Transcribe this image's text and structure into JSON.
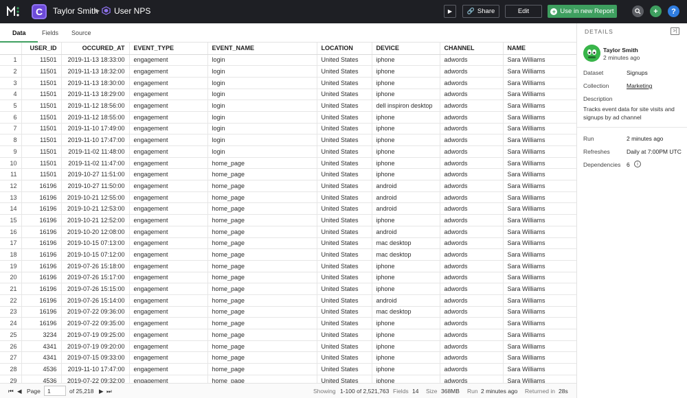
{
  "topbar": {
    "app_initial": "C",
    "user": "Taylor Smith",
    "title": "User NPS",
    "share_label": "Share",
    "edit_label": "Edit",
    "use_label": "Use in new Report",
    "help_label": "?"
  },
  "tabs": [
    {
      "label": "Data"
    },
    {
      "label": "Fields"
    },
    {
      "label": "Source"
    }
  ],
  "table": {
    "columns": [
      "USER_ID",
      "OCCURED_AT",
      "EVENT_TYPE",
      "EVENT_NAME",
      "LOCATION",
      "DEVICE",
      "CHANNEL",
      "NAME"
    ],
    "rows": [
      [
        "1",
        "11501",
        "2019-11-13 18:33:00",
        "engagement",
        "login",
        "United States",
        "iphone",
        "adwords",
        "Sara Williams"
      ],
      [
        "2",
        "11501",
        "2019-11-13 18:32:00",
        "engagement",
        "login",
        "United States",
        "iphone",
        "adwords",
        "Sara Williams"
      ],
      [
        "3",
        "11501",
        "2019-11-13 18:30:00",
        "engagement",
        "login",
        "United States",
        "iphone",
        "adwords",
        "Sara Williams"
      ],
      [
        "4",
        "11501",
        "2019-11-13 18:29:00",
        "engagement",
        "login",
        "United States",
        "iphone",
        "adwords",
        "Sara Williams"
      ],
      [
        "5",
        "11501",
        "2019-11-12 18:56:00",
        "engagement",
        "login",
        "United States",
        "dell inspiron desktop",
        "adwords",
        "Sara Williams"
      ],
      [
        "6",
        "11501",
        "2019-11-12 18:55:00",
        "engagement",
        "login",
        "United States",
        "iphone",
        "adwords",
        "Sara Williams"
      ],
      [
        "7",
        "11501",
        "2019-11-10 17:49:00",
        "engagement",
        "login",
        "United States",
        "iphone",
        "adwords",
        "Sara Williams"
      ],
      [
        "8",
        "11501",
        "2019-11-10 17:47:00",
        "engagement",
        "login",
        "United States",
        "iphone",
        "adwords",
        "Sara Williams"
      ],
      [
        "9",
        "11501",
        "2019-11-02 11:48:00",
        "engagement",
        "login",
        "United States",
        "iphone",
        "adwords",
        "Sara Williams"
      ],
      [
        "10",
        "11501",
        "2019-11-02 11:47:00",
        "engagement",
        "home_page",
        "United States",
        "iphone",
        "adwords",
        "Sara Williams"
      ],
      [
        "11",
        "11501",
        "2019-10-27 11:51:00",
        "engagement",
        "home_page",
        "United States",
        "iphone",
        "adwords",
        "Sara Williams"
      ],
      [
        "12",
        "16196",
        "2019-10-27 11:50:00",
        "engagement",
        "home_page",
        "United States",
        "android",
        "adwords",
        "Sara Williams"
      ],
      [
        "13",
        "16196",
        "2019-10-21 12:55:00",
        "engagement",
        "home_page",
        "United States",
        "android",
        "adwords",
        "Sara Williams"
      ],
      [
        "14",
        "16196",
        "2019-10-21 12:53:00",
        "engagement",
        "home_page",
        "United States",
        "android",
        "adwords",
        "Sara Williams"
      ],
      [
        "15",
        "16196",
        "2019-10-21 12:52:00",
        "engagement",
        "home_page",
        "United States",
        "iphone",
        "adwords",
        "Sara Williams"
      ],
      [
        "16",
        "16196",
        "2019-10-20 12:08:00",
        "engagement",
        "home_page",
        "United States",
        "android",
        "adwords",
        "Sara Williams"
      ],
      [
        "17",
        "16196",
        "2019-10-15 07:13:00",
        "engagement",
        "home_page",
        "United States",
        "mac desktop",
        "adwords",
        "Sara Williams"
      ],
      [
        "18",
        "16196",
        "2019-10-15 07:12:00",
        "engagement",
        "home_page",
        "United States",
        "mac desktop",
        "adwords",
        "Sara Williams"
      ],
      [
        "19",
        "16196",
        "2019-07-26 15:18:00",
        "engagement",
        "home_page",
        "United States",
        "iphone",
        "adwords",
        "Sara Williams"
      ],
      [
        "20",
        "16196",
        "2019-07-26 15:17:00",
        "engagement",
        "home_page",
        "United States",
        "iphone",
        "adwords",
        "Sara Williams"
      ],
      [
        "21",
        "16196",
        "2019-07-26 15:15:00",
        "engagement",
        "home_page",
        "United States",
        "iphone",
        "adwords",
        "Sara Williams"
      ],
      [
        "22",
        "16196",
        "2019-07-26 15:14:00",
        "engagement",
        "home_page",
        "United States",
        "android",
        "adwords",
        "Sara Williams"
      ],
      [
        "23",
        "16196",
        "2019-07-22 09:36:00",
        "engagement",
        "home_page",
        "United States",
        "mac desktop",
        "adwords",
        "Sara Williams"
      ],
      [
        "24",
        "16196",
        "2019-07-22 09:35:00",
        "engagement",
        "home_page",
        "United States",
        "iphone",
        "adwords",
        "Sara Williams"
      ],
      [
        "25",
        "3234",
        "2019-07-19 09:25:00",
        "engagement",
        "home_page",
        "United States",
        "iphone",
        "adwords",
        "Sara Williams"
      ],
      [
        "26",
        "4341",
        "2019-07-19 09:20:00",
        "engagement",
        "home_page",
        "United States",
        "iphone",
        "adwords",
        "Sara Williams"
      ],
      [
        "27",
        "4341",
        "2019-07-15 09:33:00",
        "engagement",
        "home_page",
        "United States",
        "iphone",
        "adwords",
        "Sara Williams"
      ],
      [
        "28",
        "4536",
        "2019-11-10 17:47:00",
        "engagement",
        "home_page",
        "United States",
        "iphone",
        "adwords",
        "Sara Williams"
      ],
      [
        "29",
        "4536",
        "2019-07-22 09:32:00",
        "engagement",
        "home_page",
        "United States",
        "iphone",
        "adwords",
        "Sara Williams"
      ]
    ]
  },
  "footer": {
    "page_label": "Page",
    "page_value": "1",
    "page_total": "of 25,218",
    "showing_label": "Showing",
    "showing_value": "1-100 of 2,521,763",
    "fields_label": "Fields",
    "fields_value": "14",
    "size_label": "Size",
    "size_value": "368MB",
    "run_label": "Run",
    "run_value": "2 minutes ago",
    "returned_label": "Returned in",
    "returned_value": "28s"
  },
  "details": {
    "header": "DETAILS",
    "user": "Taylor Smith",
    "user_time": "2 minutes ago",
    "dataset_label": "Dataset",
    "dataset_value": "Signups",
    "collection_label": "Collection",
    "collection_value": "Marketing",
    "description_label": "Description",
    "description_value": "Tracks event data for site visits and signups by ad channel",
    "run_label": "Run",
    "run_value": "2 minutes ago",
    "refreshes_label": "Refreshes",
    "refreshes_value": "Daily at 7:00PM UTC",
    "dependencies_label": "Dependencies",
    "dependencies_value": "6"
  },
  "colors": {
    "topbar_bg": "#1e1f24",
    "accent_green": "#3e9f5f",
    "app_purple": "#6d4ad8",
    "help_blue": "#2f7de1"
  },
  "icons": [
    "metabase-logo-icon",
    "app-icon",
    "chevron-right-icon",
    "cube-icon",
    "play-icon",
    "share-icon",
    "plus-circle-icon",
    "search-icon",
    "add-icon",
    "help-icon",
    "first-page-icon",
    "prev-page-icon",
    "next-page-icon",
    "last-page-icon",
    "collapse-panel-icon",
    "info-icon"
  ]
}
